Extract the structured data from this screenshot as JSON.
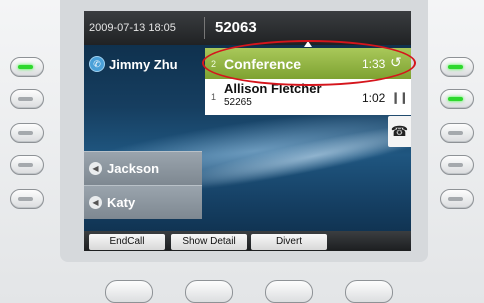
{
  "header": {
    "datetime": "2009-07-13 18:05",
    "extension": "52063"
  },
  "line": {
    "icon": "line-phone-icon",
    "name": "Jimmy Zhu"
  },
  "calls": [
    {
      "index": "2",
      "name": "Conference",
      "subtext": "",
      "duration": "1:33",
      "status_icon": "active-call-icon",
      "active": true
    },
    {
      "index": "1",
      "name": "Allison Fletcher",
      "subtext": "52265",
      "duration": "1:02",
      "status_icon": "hold-icon",
      "active": false
    }
  ],
  "speed_dials": [
    {
      "icon": "speed-dial-icon",
      "label": "Jackson"
    },
    {
      "icon": "speed-dial-icon",
      "label": "Katy"
    }
  ],
  "softkeys": [
    "EndCall",
    "Show Detail",
    "Divert"
  ],
  "line_button_leds": {
    "left": [
      "green",
      "off",
      "off",
      "off",
      "off"
    ],
    "right": [
      "green",
      "green",
      "off",
      "off",
      "off"
    ]
  },
  "colors": {
    "active_call": "#8fb13f",
    "led_on": "#2ed82e",
    "annotation": "#d5151c"
  },
  "handset_icon": "end-call-handset-icon"
}
